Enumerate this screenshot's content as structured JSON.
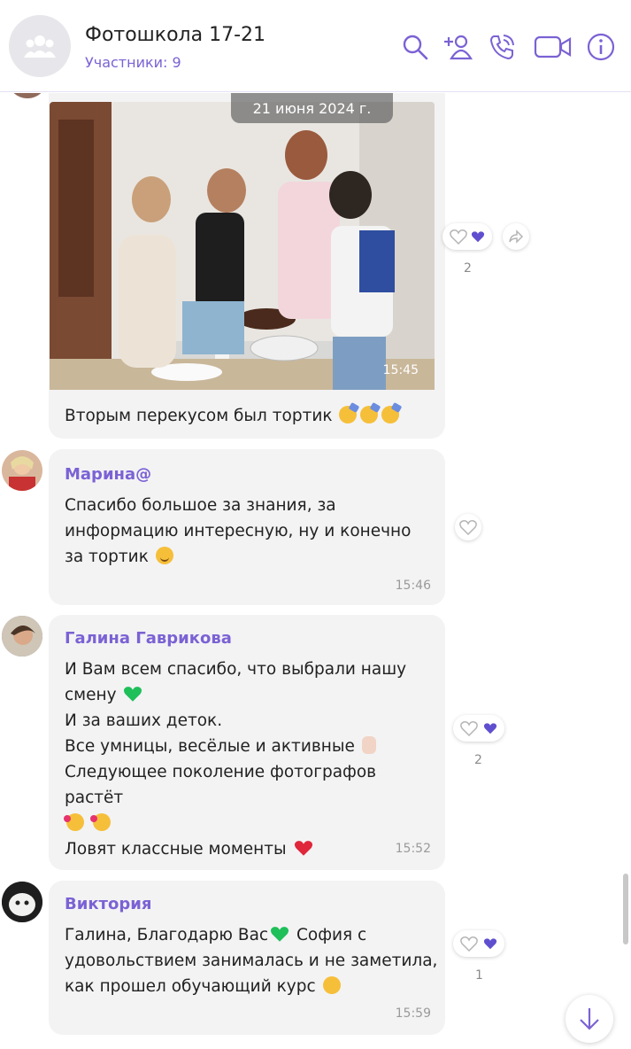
{
  "header": {
    "title": "Фотошкола 17-21",
    "subtitle": "Участники: 9",
    "icons": [
      "search-icon",
      "add-participant-icon",
      "call-icon",
      "video-call-icon",
      "info-icon"
    ]
  },
  "date_divider": "21 июня 2024 г.",
  "colors": {
    "accent": "#7b62d4",
    "bubble": "#f3f3f4",
    "time": "#9a9a9a"
  },
  "messages": [
    {
      "type": "photo",
      "time": "15:45",
      "caption": "Вторым перекусом был тортик",
      "emojis": [
        "partying-face",
        "partying-face",
        "partying-face"
      ],
      "reactions": {
        "count": "2",
        "heart_filled": true
      }
    },
    {
      "sender": "Марина@",
      "text": "Спасибо большое за знания, за информацию интересную, ну и конечно за тортик",
      "emoji_end": "smiling-face",
      "time": "15:46",
      "reactions": {
        "count": "",
        "heart_filled": false
      }
    },
    {
      "sender": "Галина Гаврикова",
      "lines": [
        "И Вам всем спасибо, что выбрали нашу",
        "смену",
        "И за ваших деток.",
        "Все умницы, весёлые и активные",
        "Следующее поколение фотографов растёт",
        "Ловят классные моменты"
      ],
      "time": "15:52",
      "reactions": {
        "count": "2",
        "heart_filled": true
      }
    },
    {
      "sender": "Виктория",
      "lines": [
        "Галина, Благодарю Вас",
        "София с",
        "удовольствием занималась и не заметила,",
        "как прошел обучающий курс"
      ],
      "time": "15:59",
      "reactions": {
        "count": "1",
        "heart_filled": true
      }
    }
  ]
}
